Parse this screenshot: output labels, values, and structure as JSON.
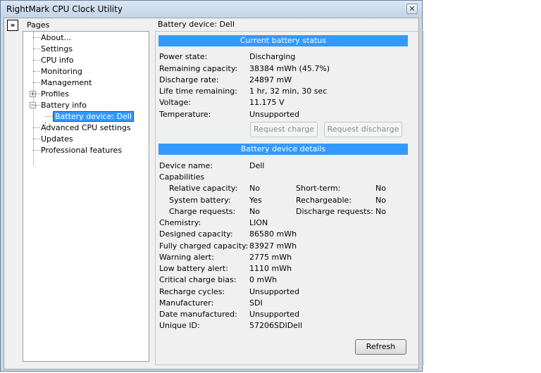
{
  "window": {
    "title": "RightMark CPU Clock Utility",
    "close_glyph": "✕"
  },
  "sidebar": {
    "header": "Pages",
    "expand_glyph": "»",
    "items": [
      {
        "label": "About..."
      },
      {
        "label": "Settings"
      },
      {
        "label": "CPU info"
      },
      {
        "label": "Monitoring"
      },
      {
        "label": "Management"
      },
      {
        "label": "Profiles",
        "toggle": "+"
      },
      {
        "label": "Battery info",
        "toggle": "−"
      },
      {
        "label": "Battery device: Dell"
      },
      {
        "label": "Advanced CPU settings"
      },
      {
        "label": "Updates"
      },
      {
        "label": "Professional features"
      }
    ]
  },
  "main": {
    "title": "Battery device: Dell",
    "status": {
      "header": "Current battery status",
      "rows": [
        {
          "label": "Power state:",
          "value": "Discharging"
        },
        {
          "label": "Remaining capacity:",
          "value": "38384 mWh (45.7%)"
        },
        {
          "label": "Discharge rate:",
          "value": "24897 mW"
        },
        {
          "label": "Life time remaining:",
          "value": "1 hr, 32 min, 30 sec"
        },
        {
          "label": "Voltage:",
          "value": "11.175 V"
        },
        {
          "label": "Temperature:",
          "value": "Unsupported"
        }
      ],
      "request_charge": "Request charge",
      "request_discharge": "Request discharge"
    },
    "details": {
      "header": "Battery device details",
      "device_name": {
        "label": "Device name:",
        "value": "Dell"
      },
      "capabilities_label": "Capabilities",
      "capabilities": [
        {
          "label": "Relative capacity:",
          "value": "No",
          "label2": "Short-term:",
          "value2": "No"
        },
        {
          "label": "System battery:",
          "value": "Yes",
          "label2": "Rechargeable:",
          "value2": "No"
        },
        {
          "label": "Charge requests:",
          "value": "No",
          "label2": "Discharge requests:",
          "value2": "No"
        }
      ],
      "rows": [
        {
          "label": "Chemistry:",
          "value": "LION"
        },
        {
          "label": "Designed capacity:",
          "value": "86580 mWh"
        },
        {
          "label": "Fully charged capacity:",
          "value": "83927 mWh"
        },
        {
          "label": "Warning alert:",
          "value": "2775 mWh"
        },
        {
          "label": "Low battery alert:",
          "value": "1110 mWh"
        },
        {
          "label": "Critical charge bias:",
          "value": "0 mWh"
        },
        {
          "label": "Recharge cycles:",
          "value": "Unsupported"
        },
        {
          "label": "Manufacturer:",
          "value": "SDI"
        },
        {
          "label": "Date manufactured:",
          "value": "Unsupported"
        },
        {
          "label": "Unique ID:",
          "value": "57206SDIDell"
        }
      ]
    },
    "refresh": "Refresh"
  }
}
